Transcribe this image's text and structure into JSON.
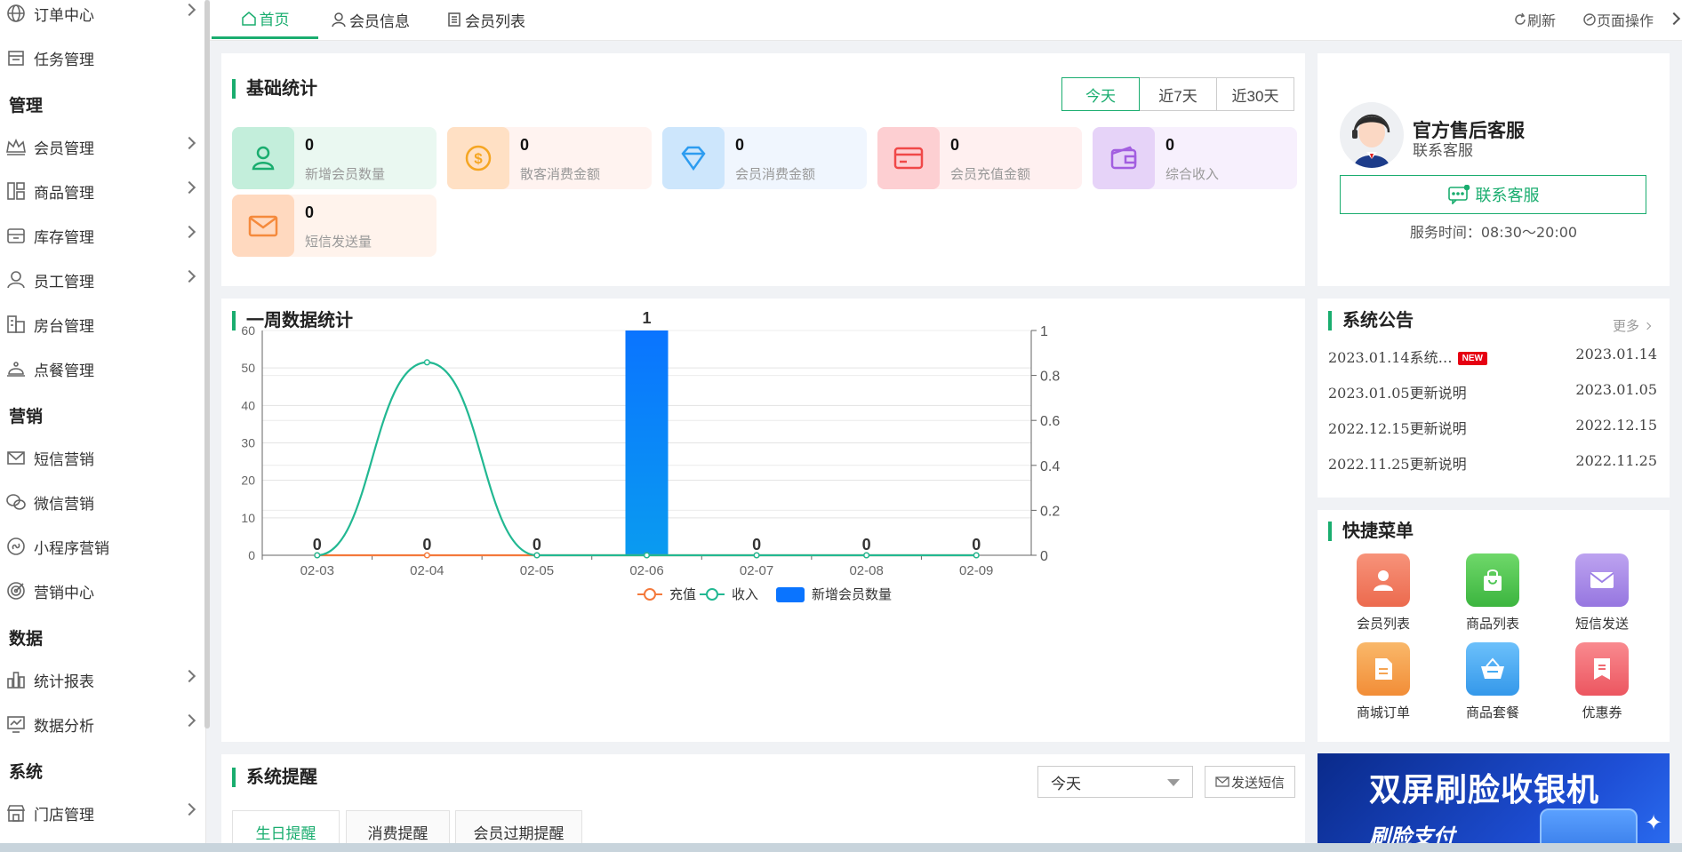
{
  "sidebar": {
    "items": [
      {
        "label": "订单中心",
        "icon": "globe-icon",
        "arrow": true
      },
      {
        "label": "任务管理",
        "icon": "calendar-icon",
        "arrow": false
      },
      {
        "label": "会员管理",
        "icon": "crown-icon",
        "arrow": true
      },
      {
        "label": "商品管理",
        "icon": "grid-icon",
        "arrow": true
      },
      {
        "label": "库存管理",
        "icon": "box-icon",
        "arrow": true
      },
      {
        "label": "员工管理",
        "icon": "user-icon",
        "arrow": true
      },
      {
        "label": "房台管理",
        "icon": "building-icon",
        "arrow": false
      },
      {
        "label": "点餐管理",
        "icon": "bell-icon",
        "arrow": false
      },
      {
        "label": "短信营销",
        "icon": "mail-icon",
        "arrow": false
      },
      {
        "label": "微信营销",
        "icon": "wechat-icon",
        "arrow": false
      },
      {
        "label": "小程序营销",
        "icon": "miniprogram-icon",
        "arrow": false
      },
      {
        "label": "营销中心",
        "icon": "target-icon",
        "arrow": false
      },
      {
        "label": "统计报表",
        "icon": "bar-chart-icon",
        "arrow": true
      },
      {
        "label": "数据分析",
        "icon": "monitor-chart-icon",
        "arrow": true
      },
      {
        "label": "门店管理",
        "icon": "store-icon",
        "arrow": true
      }
    ],
    "sections": [
      "管理",
      "营销",
      "数据",
      "系统"
    ]
  },
  "topbar": {
    "tabs": [
      "首页",
      "会员信息",
      "会员列表"
    ],
    "refresh": "刷新",
    "page_ops": "页面操作"
  },
  "basic": {
    "title": "基础统计",
    "ranges": [
      "今天",
      "近7天",
      "近30天"
    ],
    "stats": [
      {
        "value": "0",
        "label": "新增会员数量",
        "icon": "user-icon",
        "color": "#1aad6f"
      },
      {
        "value": "0",
        "label": "散客消费金额",
        "icon": "coin-icon",
        "color": "#f5a623"
      },
      {
        "value": "0",
        "label": "会员消费金额",
        "icon": "diamond-icon",
        "color": "#2d9cf0"
      },
      {
        "value": "0",
        "label": "会员充值金额",
        "icon": "card-icon",
        "color": "#f04848"
      },
      {
        "value": "0",
        "label": "综合收入",
        "icon": "wallet-icon",
        "color": "#a25ee0"
      },
      {
        "value": "0",
        "label": "短信发送量",
        "icon": "envelope-icon",
        "color": "#f58a3c"
      }
    ]
  },
  "weekly": {
    "title": "一周数据统计"
  },
  "chart_data": {
    "type": "bar",
    "categories": [
      "02-03",
      "02-04",
      "02-05",
      "02-06",
      "02-07",
      "02-08",
      "02-09"
    ],
    "series": [
      {
        "name": "充值",
        "type": "line",
        "axis": "left",
        "values": [
          0,
          0,
          0,
          0,
          0,
          0,
          0
        ],
        "color": "#f4793b"
      },
      {
        "name": "收入",
        "type": "line",
        "axis": "left",
        "values": [
          0,
          51.5,
          0,
          0,
          0,
          0,
          0
        ],
        "color": "#22b892"
      },
      {
        "name": "新增会员数量",
        "type": "bar",
        "axis": "right",
        "values": [
          0,
          0,
          0,
          1,
          0,
          0,
          0
        ],
        "color": "#0a74ff"
      }
    ],
    "bar_labels": [
      "0",
      "0",
      "0",
      "1",
      "0",
      "0",
      "0"
    ],
    "yticks_left": [
      "0",
      "10",
      "20",
      "30",
      "40",
      "50",
      "60"
    ],
    "yticks_right": [
      "0",
      "0.2",
      "0.4",
      "0.6",
      "0.8",
      "1"
    ],
    "ylim_left": [
      0,
      60
    ],
    "ylim_right": [
      0,
      1
    ],
    "legend": [
      "充值",
      "收入",
      "新增会员数量"
    ],
    "legend_position": "bottom-center",
    "grid": true
  },
  "service": {
    "name": "官方售后客服",
    "sub": "联系客服",
    "button": "联系客服",
    "hours": "服务时间：08:30～20:00"
  },
  "notice": {
    "title": "系统公告",
    "more": "更多",
    "new_badge": "NEW",
    "rows": [
      {
        "text": "2023.01.14系统…",
        "date": "2023.01.14"
      },
      {
        "text": "2023.01.05更新说明",
        "date": "2023.01.05"
      },
      {
        "text": "2022.12.15更新说明",
        "date": "2022.12.15"
      },
      {
        "text": "2022.11.25更新说明",
        "date": "2022.11.25"
      }
    ]
  },
  "quick": {
    "title": "快捷菜单",
    "items": [
      {
        "label": "会员列表",
        "icon": "member-icon",
        "color": "#f07a56"
      },
      {
        "label": "商品列表",
        "icon": "bag-icon",
        "color": "#4cc552"
      },
      {
        "label": "短信发送",
        "icon": "envelope-icon",
        "color": "#a88ae6"
      },
      {
        "label": "商城订单",
        "icon": "document-icon",
        "color": "#f5a452"
      },
      {
        "label": "商品套餐",
        "icon": "basket-icon",
        "color": "#45aaf2"
      },
      {
        "label": "优惠券",
        "icon": "coupon-icon",
        "color": "#f06a72"
      }
    ]
  },
  "ad": {
    "headline": "双屏刷脸收银机",
    "sub": "刷脸支付"
  },
  "reminder": {
    "title": "系统提醒",
    "select": "今天",
    "send": "发送短信",
    "tabs": [
      "生日提醒",
      "消费提醒",
      "会员过期提醒"
    ]
  }
}
